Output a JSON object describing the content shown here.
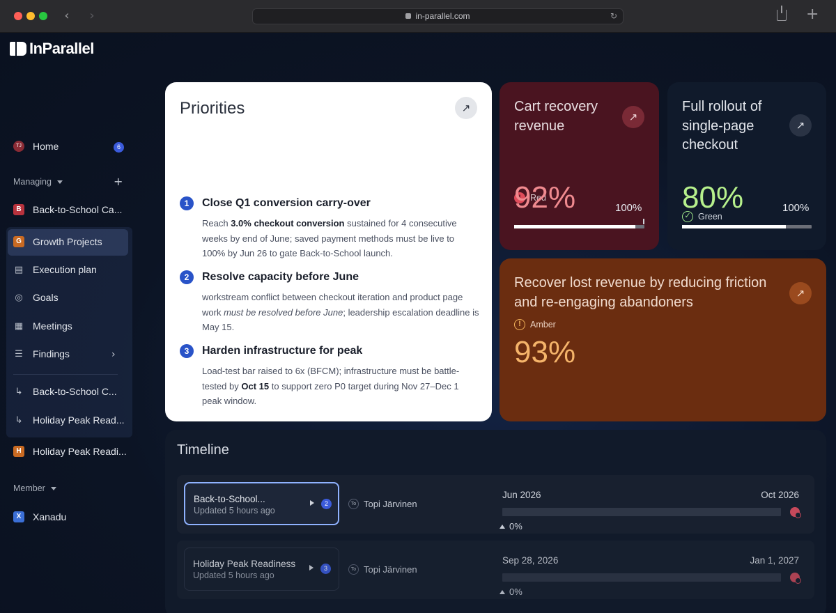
{
  "browser": {
    "url": "in-parallel.com"
  },
  "app": {
    "logo_text": "InParallel"
  },
  "sidebar": {
    "home": {
      "label": "Home",
      "avatar": "TJ",
      "badge": "6"
    },
    "managing_label": "Managing",
    "items": [
      {
        "label": "Back-to-School Ca...",
        "marker": "B"
      },
      {
        "label": "Growth Projects",
        "marker": "G"
      },
      {
        "label": "Execution plan",
        "icon": "document-icon"
      },
      {
        "label": "Goals",
        "icon": "target-icon"
      },
      {
        "label": "Meetings",
        "icon": "calendar-icon"
      },
      {
        "label": "Findings",
        "icon": "list-icon"
      },
      {
        "label": "Back-to-School C...",
        "icon": "sub-arrow-icon"
      },
      {
        "label": "Holiday Peak Read...",
        "icon": "sub-arrow-icon"
      },
      {
        "label": "Holiday Peak Readi...",
        "marker": "H"
      }
    ],
    "member_label": "Member",
    "member_items": [
      {
        "label": "Xanadu",
        "marker": "X"
      }
    ]
  },
  "priorities": {
    "title": "Priorities",
    "items": [
      {
        "num": "1",
        "title": "Close Q1 conversion carry-over",
        "p1": "Reach ",
        "b1": "3.0% checkout conversion",
        "p2": " sustained for 4 consecutive weeks by end of June; saved payment methods must be live to 100% by Jun 26 to gate Back-to-School launch."
      },
      {
        "num": "2",
        "title": "Resolve capacity before June",
        "p1": "workstream conflict between checkout iteration and product page work ",
        "i1": "must be resolved before June",
        "p2": "; leadership escalation deadline is May 15."
      },
      {
        "num": "3",
        "title": "Harden infrastructure for peak",
        "p1": "Load-test bar raised to 6x (BFCM); infrastructure must be battle-tested by ",
        "b1": "Oct 15",
        "p2": " to support zero P0 target during Nov 27–Dec 1 peak window."
      }
    ]
  },
  "metrics": {
    "cart": {
      "title": "Cart recovery revenue",
      "status": "Red",
      "status_mark": "!",
      "percent": "92%",
      "target": "100%",
      "progress": 0.93
    },
    "rollout": {
      "title": "Full rollout of single-page checkout",
      "status": "Green",
      "status_mark": "✓",
      "percent": "80%",
      "target": "100%",
      "progress": 0.8
    },
    "recover": {
      "title": "Recover lost revenue by reducing friction and re-engaging abandoners",
      "status": "Amber",
      "status_mark": "!",
      "percent": "93%"
    }
  },
  "timeline": {
    "title": "Timeline",
    "rows": [
      {
        "name": "Back-to-School...",
        "updated": "Updated 5 hours ago",
        "count": "2",
        "owner_initials": "To",
        "owner": "Topi Järvinen",
        "start": "Jun 2026",
        "end": "Oct 2026",
        "progress": "0%"
      },
      {
        "name": "Holiday Peak Readiness",
        "updated": "Updated 5 hours ago",
        "count": "3",
        "owner_initials": "To",
        "owner": "Topi Järvinen",
        "start": "Sep 28, 2026",
        "end": "Jan 1, 2027",
        "progress": "0%"
      }
    ]
  },
  "colors": {
    "accent": "#3b5bdb",
    "red_card": "#4a1420",
    "amber_card": "#6b2d10",
    "green_value": "#b6f08c"
  }
}
